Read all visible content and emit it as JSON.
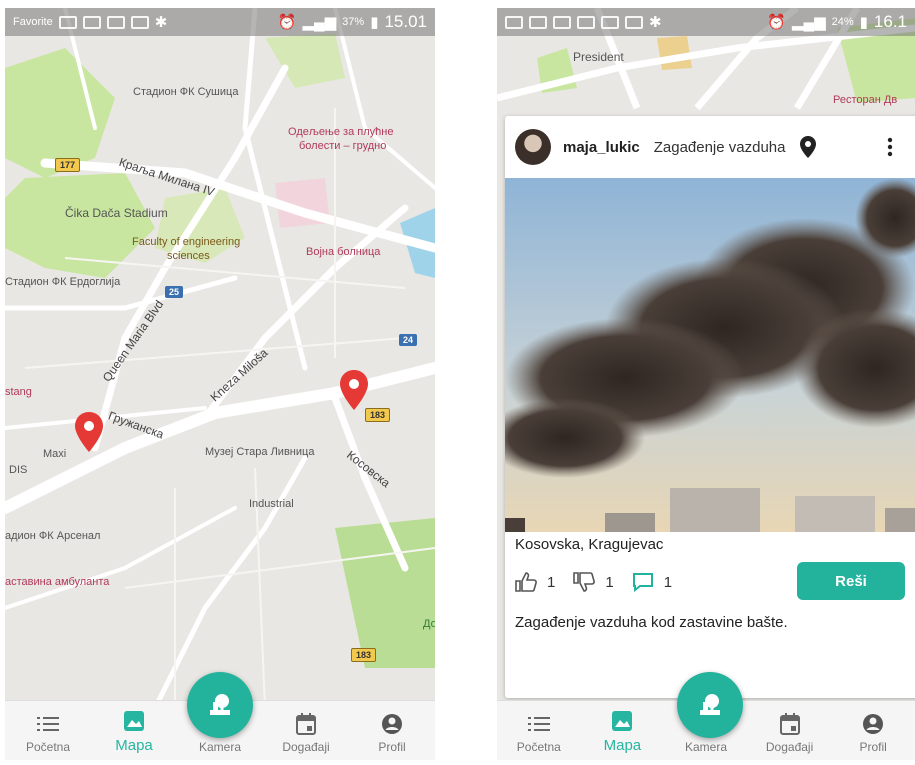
{
  "colors": {
    "accent": "#23b39c",
    "pin": "#e53935",
    "map_bg": "#e9e7e3",
    "park": "#c8e6a0",
    "water": "#9fd3ea"
  },
  "left_phone": {
    "status": {
      "battery": "37%",
      "time": "15.01",
      "carrier": "Favorite"
    },
    "map_labels": {
      "stadion_susica": "Стадион ФК Сушица",
      "odeljenje": "Одељење за плућне",
      "odeljenje2": "болести – грудно",
      "kralja_milana": "Краља Милана IV",
      "cika_daca": "Čika Dača Stadium",
      "faculty": "Faculty of engineering",
      "faculty2": "sciences",
      "vojna": "Војна болница",
      "erdoglija": "Стадион ФК Ердоглија",
      "queen_maria": "Queen Maria Blvd",
      "kneza_milosa": "Kneza Miloša",
      "stang": "stang",
      "gruzanska": "Гружанска",
      "maxi": "Maxi",
      "dis": "DIS",
      "muzej": "Музеј Стара Ливница",
      "kosovska": "Косовска",
      "industrial": "Industrial",
      "arsenal": "адион ФК Арсенал",
      "ambulanta": "аставина амбуланта",
      "do": "До"
    },
    "shields": {
      "r177": "177",
      "r25": "25",
      "r24": "24",
      "r183a": "183",
      "r183b": "183"
    },
    "nav": [
      {
        "label": "Početna",
        "icon": "list-icon"
      },
      {
        "label": "Mapa",
        "icon": "map-icon"
      },
      {
        "label": "Kamera",
        "icon": "camera-icon"
      },
      {
        "label": "Događaji",
        "icon": "calendar-icon"
      },
      {
        "label": "Profil",
        "icon": "profile-icon"
      }
    ]
  },
  "right_phone": {
    "status": {
      "battery": "24%",
      "time": "16.1"
    },
    "map_labels": {
      "president": "President",
      "restoran": "Ресторан Дв"
    },
    "post": {
      "username": "maja_lukic",
      "category": "Zagađenje vazduha",
      "address": "Kosovska, Kragujevac",
      "likes": "1",
      "dislikes": "1",
      "comments": "1",
      "action_label": "Reši",
      "description": "Zagađenje vazduha kod zastavine bašte."
    },
    "nav": [
      {
        "label": "Početna",
        "icon": "list-icon"
      },
      {
        "label": "Mapa",
        "icon": "map-icon"
      },
      {
        "label": "Kamera",
        "icon": "camera-icon"
      },
      {
        "label": "Događaji",
        "icon": "calendar-icon"
      },
      {
        "label": "Profil",
        "icon": "profile-icon"
      }
    ]
  }
}
